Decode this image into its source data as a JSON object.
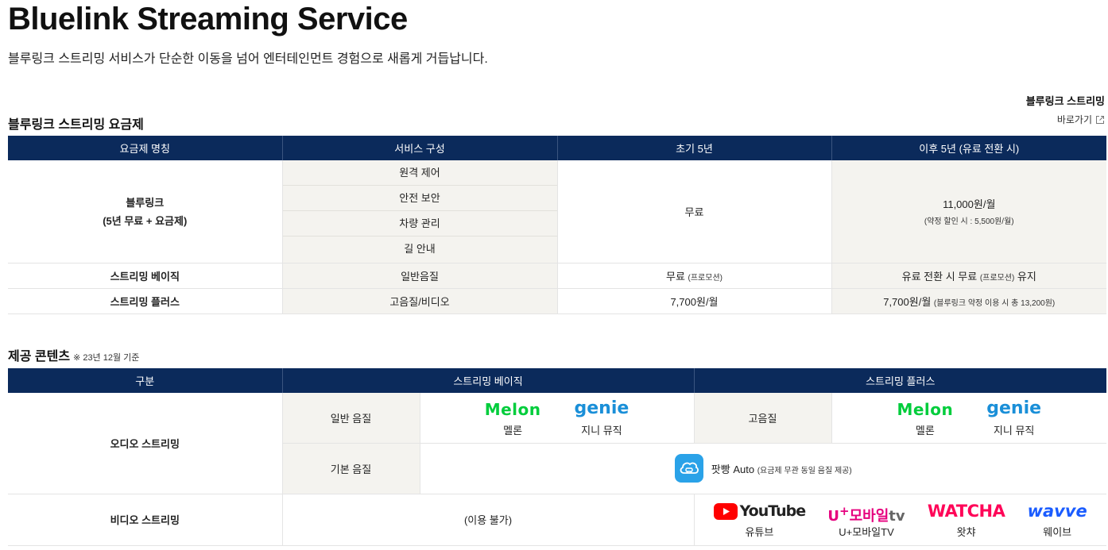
{
  "header": {
    "title": "Bluelink Streaming Service",
    "subtitle": "블루링크 스트리밍 서비스가 단순한 이동을 넘어 엔터테인먼트 경험으로 새롭게 거듭납니다."
  },
  "shortcut": {
    "title": "블루링크 스트리밍",
    "link_label": "바로가기"
  },
  "plans": {
    "section_title": "블루링크 스트리밍 요금제",
    "columns": [
      "요금제 명칭",
      "서비스 구성",
      "초기 5년",
      "이후 5년 (유료 전환 시)"
    ],
    "bluelink": {
      "name_line1": "블루링크",
      "name_line2": "(5년 무료 + 요금제)",
      "services": [
        "원격 제어",
        "안전 보안",
        "차량 관리",
        "길 안내"
      ],
      "initial": "무료",
      "after_price": "11,000원/월",
      "after_note": "(약정 할인 시 : 5,500원/월)"
    },
    "basic": {
      "name": "스트리밍 베이직",
      "service": "일반음질",
      "initial": "무료",
      "initial_note": "(프로모션)",
      "after_pre": "유료 전환 시 무료",
      "after_note": "(프로모션)",
      "after_post": "유지"
    },
    "plus": {
      "name": "스트리밍 플러스",
      "service": "고음질/비디오",
      "initial": "7,700원/월",
      "after_price": "7,700원/월",
      "after_note": "(블루링크 약정 이용 시 총 13,200원)"
    }
  },
  "contents": {
    "section_title": "제공 콘텐츠",
    "section_note": "※ 23년 12월 기준",
    "columns": [
      "구분",
      "스트리밍 베이직",
      "스트리밍 플러스"
    ],
    "audio": {
      "label": "오디오 스트리밍",
      "basic_quality_1": "일반 음질",
      "basic_quality_2": "기본 음질",
      "plus_quality": "고음질",
      "melon_logo": "Melon",
      "melon_caption": "멜론",
      "genie_logo": "genie",
      "genie_caption": "지니 뮤직",
      "patpang_name": "팟빵 Auto",
      "patpang_note": "(요금제 무관 동일 음질 제공)"
    },
    "video": {
      "label": "비디오 스트리밍",
      "basic_unavailable": "(이용 불가)",
      "youtube_logo": "YouTube",
      "youtube_caption": "유튜브",
      "uplus_logo_u": "U",
      "uplus_logo_plus": "+",
      "uplus_logo_rest": "모바일",
      "uplus_logo_tv": "tv",
      "uplus_caption": "U+모바일TV",
      "watcha_logo": "WATCHA",
      "watcha_caption": "왓챠",
      "wavve_logo": "wavve",
      "wavve_caption": "웨이브"
    }
  },
  "colors": {
    "header_bg": "#0b2a5b",
    "grey_cell": "#f4f3ef",
    "melon": "#00cd3c",
    "genie": "#1a8fd8",
    "youtube": "#ff0000",
    "uplus": "#e6007e",
    "watcha": "#ff0558",
    "wavve": "#1a5cff",
    "patpang": "#2aa2e8"
  },
  "icons": [
    "external-link-icon",
    "youtube-play-icon",
    "patpang-icon"
  ]
}
